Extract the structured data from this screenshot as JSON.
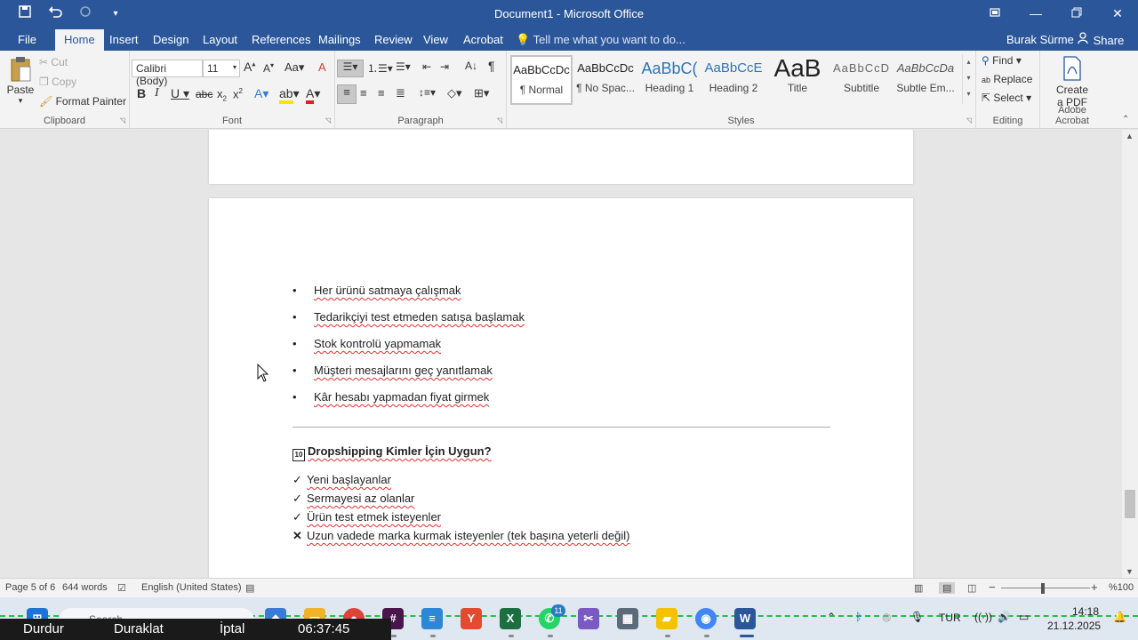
{
  "titlebar": {
    "title": "Document1 - Microsoft Office",
    "icons": [
      "save-icon",
      "undo-icon",
      "redo-icon",
      "customize-qat-icon"
    ],
    "window_controls": [
      "restore-icon",
      "minimize-icon",
      "maximize-icon",
      "close-icon"
    ]
  },
  "tabs": {
    "file": "File",
    "home": "Home",
    "insert": "Insert",
    "design": "Design",
    "layout": "Layout",
    "references": "References",
    "mailings": "Mailings",
    "review": "Review",
    "view": "View",
    "acrobat": "Acrobat",
    "tell_me": "Tell me what you want to do...",
    "user": "Burak Sürme",
    "share": "Share"
  },
  "ribbon": {
    "clipboard": {
      "label": "Clipboard",
      "paste": "Paste",
      "cut": "Cut",
      "copy": "Copy",
      "format_painter": "Format Painter"
    },
    "font": {
      "label": "Font",
      "font_name": "Calibri (Body)",
      "font_size": "11"
    },
    "paragraph": {
      "label": "Paragraph"
    },
    "styles": {
      "label": "Styles",
      "items": [
        {
          "sample": "AaBbCcDc",
          "name": "¶ Normal"
        },
        {
          "sample": "AaBbCcDc",
          "name": "¶ No Spac..."
        },
        {
          "sample": "AaBbC(",
          "name": "Heading 1"
        },
        {
          "sample": "AaBbCcE",
          "name": "Heading 2"
        },
        {
          "sample": "AaB",
          "name": "Title"
        },
        {
          "sample": "AaBbCcD",
          "name": "Subtitle"
        },
        {
          "sample": "AaBbCcDa",
          "name": "Subtle Em..."
        }
      ]
    },
    "editing": {
      "label": "Editing",
      "find": "Find",
      "replace": "Replace",
      "select": "Select"
    },
    "acrobat": {
      "label": "Adobe Acrobat",
      "create_line1": "Create",
      "create_line2": "a PDF"
    }
  },
  "document": {
    "bullets": [
      "Her ürünü satmaya çalışmak",
      "Tedarikçiyi test etmeden satışa başlamak",
      "Stok kontrolü yapmamak",
      "Müşteri mesajlarını geç yanıtlamak",
      "Kâr hesabı yapmadan fiyat girmek"
    ],
    "section_number": "10",
    "section_heading": "Dropshipping Kimler İçin Uygun?",
    "checklist": [
      {
        "mark": "✓",
        "text": "Yeni başlayanlar"
      },
      {
        "mark": "✓",
        "text": "Sermayesi az olanlar"
      },
      {
        "mark": "✓",
        "text": "Ürün test etmek isteyenler"
      },
      {
        "mark": "✕",
        "text": "Uzun vadede marka kurmak isteyenler (tek başına yeterli değil)"
      }
    ]
  },
  "statusbar": {
    "page": "Page 5 of 6",
    "words": "644 words",
    "language": "English (United States)",
    "zoom_minus": "−",
    "zoom_plus": "+",
    "zoom": "%100"
  },
  "taskbar": {
    "search": "Search",
    "whatsapp_badge": "11",
    "lang": "TUR",
    "time": "14:18",
    "date": "21.12.2025"
  },
  "recorder": {
    "stop": "Durdur",
    "pause": "Duraklat",
    "cancel": "İptal",
    "timer": "06:37:45"
  }
}
